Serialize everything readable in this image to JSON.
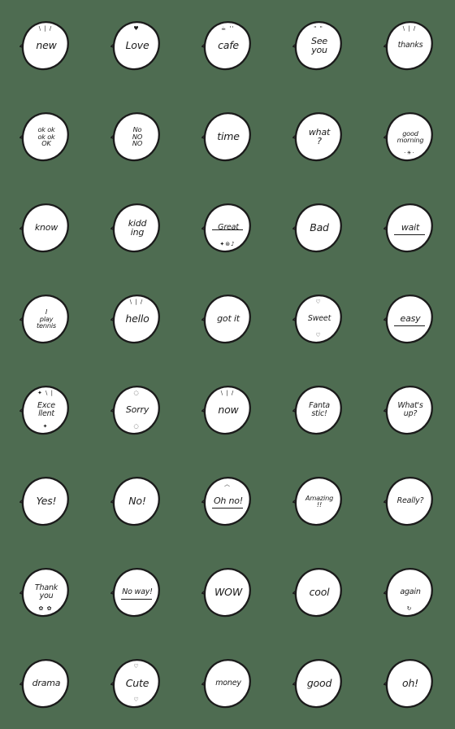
{
  "page": {
    "title": "Emoji sticker pack preview",
    "background_color": "#4e6c51",
    "bubble_fill": "#ffffff",
    "bubble_stroke": "#1b1b1b",
    "columns": 5,
    "rows": 8
  },
  "stickers": [
    {
      "id": "new",
      "text": "new",
      "lines": [
        "new"
      ],
      "size": "sz-1",
      "deco_top": "\\ | /",
      "deco_bottom": ""
    },
    {
      "id": "love",
      "text": "Love",
      "lines": [
        "Love"
      ],
      "size": "sz-1",
      "deco_top": "♥",
      "deco_bottom": ""
    },
    {
      "id": "cafe",
      "text": "cafe",
      "lines": [
        "cafe"
      ],
      "size": "sz-1",
      "deco_top": "☕ ''",
      "deco_bottom": ""
    },
    {
      "id": "see-you",
      "text": "See you",
      "lines": [
        "See",
        "you"
      ],
      "size": "sz-2",
      "deco_top": "\" \"",
      "deco_bottom": ""
    },
    {
      "id": "thanks",
      "text": "thanks",
      "lines": [
        "thanks"
      ],
      "size": "sz-3",
      "deco_top": "\\ | /",
      "deco_bottom": ""
    },
    {
      "id": "ok-ok-ok",
      "text": "ok ok ok ok OK",
      "lines": [
        "ok ok",
        "ok ok",
        "OK"
      ],
      "size": "sz-4",
      "deco_top": "",
      "deco_bottom": ""
    },
    {
      "id": "no-no-no",
      "text": "No NO NO",
      "lines": [
        "No",
        "NO",
        "NO"
      ],
      "size": "sz-4",
      "deco_top": "",
      "deco_bottom": ""
    },
    {
      "id": "time",
      "text": "time",
      "lines": [
        "time"
      ],
      "size": "sz-1",
      "deco_top": "",
      "deco_bottom": ""
    },
    {
      "id": "what",
      "text": "what ?",
      "lines": [
        "what",
        "?"
      ],
      "size": "sz-2",
      "deco_top": "",
      "deco_bottom": ""
    },
    {
      "id": "good-morning",
      "text": "good morning",
      "lines": [
        "good",
        "morning"
      ],
      "size": "sz-4",
      "deco_top": "",
      "deco_bottom": "·☀·"
    },
    {
      "id": "know",
      "text": "know",
      "lines": [
        "know"
      ],
      "size": "sz-2",
      "deco_top": "",
      "deco_bottom": ""
    },
    {
      "id": "kidding",
      "text": "kidding",
      "lines": [
        "kidd",
        "ing"
      ],
      "size": "sz-2",
      "deco_top": "",
      "deco_bottom": ""
    },
    {
      "id": "great",
      "text": "Great",
      "lines": [
        "Great"
      ],
      "size": "sz-3",
      "deco_top": "",
      "deco_bottom": "✦⊛♪"
    },
    {
      "id": "bad",
      "text": "Bad",
      "lines": [
        "Bad"
      ],
      "size": "sz-1",
      "deco_top": "",
      "deco_bottom": ""
    },
    {
      "id": "wait",
      "text": "wait",
      "lines": [
        "wait"
      ],
      "size": "sz-2",
      "deco_top": "",
      "deco_bottom": ""
    },
    {
      "id": "i-play-tennis",
      "text": "I play tennis",
      "lines": [
        "I",
        "play",
        "tennis"
      ],
      "size": "sz-4",
      "deco_top": "",
      "deco_bottom": ""
    },
    {
      "id": "hello",
      "text": "hello",
      "lines": [
        "hello"
      ],
      "size": "sz-1",
      "deco_top": "\\ | /",
      "deco_bottom": ""
    },
    {
      "id": "got-it",
      "text": "got it",
      "lines": [
        "got it"
      ],
      "size": "sz-2",
      "deco_top": "",
      "deco_bottom": ""
    },
    {
      "id": "sweet",
      "text": "Sweet",
      "lines": [
        "Sweet"
      ],
      "size": "sz-3",
      "deco_top": "♡",
      "deco_bottom": "♡"
    },
    {
      "id": "easy",
      "text": "easy",
      "lines": [
        "easy"
      ],
      "size": "sz-2",
      "deco_top": "",
      "deco_bottom": ""
    },
    {
      "id": "excellent",
      "text": "Excellent",
      "lines": [
        "Exce",
        "llent"
      ],
      "size": "sz-3",
      "deco_top": "✦ \\ |",
      "deco_bottom": "✦"
    },
    {
      "id": "sorry",
      "text": "Sorry",
      "lines": [
        "Sorry"
      ],
      "size": "sz-2",
      "deco_top": "◌",
      "deco_bottom": "◌"
    },
    {
      "id": "now",
      "text": "now",
      "lines": [
        "now"
      ],
      "size": "sz-1",
      "deco_top": "\\ | /",
      "deco_bottom": ""
    },
    {
      "id": "fantastic",
      "text": "Fantastic!",
      "lines": [
        "Fanta",
        "stic!"
      ],
      "size": "sz-3",
      "deco_top": "",
      "deco_bottom": ""
    },
    {
      "id": "whats-up",
      "text": "What's up?",
      "lines": [
        "What's",
        "up?"
      ],
      "size": "sz-3",
      "deco_top": "",
      "deco_bottom": ""
    },
    {
      "id": "yes",
      "text": "Yes!",
      "lines": [
        "Yes!"
      ],
      "size": "sz-1",
      "deco_top": "",
      "deco_bottom": ""
    },
    {
      "id": "no",
      "text": "No!",
      "lines": [
        "No!"
      ],
      "size": "sz-1",
      "deco_top": "",
      "deco_bottom": ""
    },
    {
      "id": "oh-no",
      "text": "Oh no!",
      "lines": [
        "Oh no!"
      ],
      "size": "sz-2",
      "deco_top": "︿",
      "deco_bottom": ""
    },
    {
      "id": "amazing",
      "text": "Amazing !!",
      "lines": [
        "Amazing",
        "!!"
      ],
      "size": "sz-4",
      "deco_top": "",
      "deco_bottom": ""
    },
    {
      "id": "really",
      "text": "Really?",
      "lines": [
        "Really?"
      ],
      "size": "sz-3",
      "deco_top": "",
      "deco_bottom": ""
    },
    {
      "id": "thank-you",
      "text": "Thank you",
      "lines": [
        "Thank",
        "you"
      ],
      "size": "sz-3",
      "deco_top": "",
      "deco_bottom": "✿   ✿"
    },
    {
      "id": "no-way",
      "text": "No way!",
      "lines": [
        "No way!"
      ],
      "size": "sz-3",
      "deco_top": "",
      "deco_bottom": ""
    },
    {
      "id": "wow",
      "text": "WOW",
      "lines": [
        "WOW"
      ],
      "size": "sz-1",
      "deco_top": "",
      "deco_bottom": ""
    },
    {
      "id": "cool",
      "text": "cool",
      "lines": [
        "cool"
      ],
      "size": "sz-1",
      "deco_top": "",
      "deco_bottom": ""
    },
    {
      "id": "again",
      "text": "again",
      "lines": [
        "again"
      ],
      "size": "sz-3",
      "deco_top": "",
      "deco_bottom": "↻"
    },
    {
      "id": "drama",
      "text": "drama",
      "lines": [
        "drama"
      ],
      "size": "sz-2",
      "deco_top": "",
      "deco_bottom": ""
    },
    {
      "id": "cute",
      "text": "Cute",
      "lines": [
        "Cute"
      ],
      "size": "sz-1",
      "deco_top": "♡",
      "deco_bottom": "♡"
    },
    {
      "id": "money",
      "text": "money",
      "lines": [
        "money"
      ],
      "size": "sz-3",
      "deco_top": "",
      "deco_bottom": ""
    },
    {
      "id": "good",
      "text": "good",
      "lines": [
        "good"
      ],
      "size": "sz-1",
      "deco_top": "",
      "deco_bottom": ""
    },
    {
      "id": "oh",
      "text": "oh!",
      "lines": [
        "oh!"
      ],
      "size": "sz-1",
      "deco_top": "",
      "deco_bottom": ""
    }
  ],
  "underlined": [
    "great",
    "wait",
    "easy",
    "oh-no",
    "no-way"
  ]
}
